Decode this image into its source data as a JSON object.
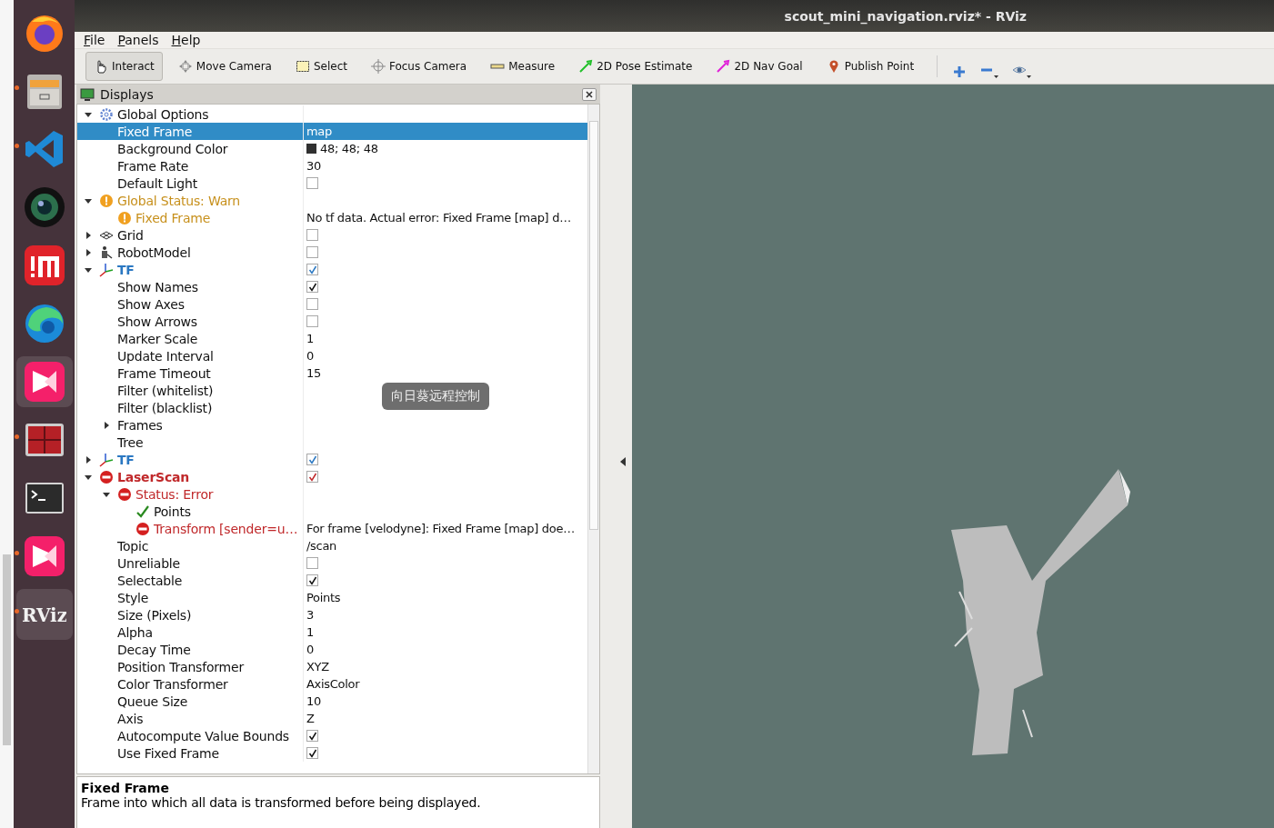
{
  "dock": [
    {
      "kind": "firefox",
      "running": false,
      "highlighted": false
    },
    {
      "kind": "files",
      "running": true,
      "highlighted": false
    },
    {
      "kind": "vscode",
      "running": true,
      "highlighted": false
    },
    {
      "kind": "camera",
      "running": false,
      "highlighted": false
    },
    {
      "kind": "im",
      "running": false,
      "highlighted": false
    },
    {
      "kind": "edge",
      "running": false,
      "highlighted": false
    },
    {
      "kind": "remote",
      "running": false,
      "highlighted": true
    },
    {
      "kind": "monitor",
      "running": true,
      "highlighted": false
    },
    {
      "kind": "terminal",
      "running": false,
      "highlighted": false
    },
    {
      "kind": "remote",
      "running": true,
      "highlighted": false
    },
    {
      "kind": "rviz",
      "running": true,
      "highlighted": true,
      "logo_text": "RViz"
    }
  ],
  "window": {
    "title": "scout_mini_navigation.rviz* - RViz"
  },
  "menu": [
    {
      "label": "File"
    },
    {
      "label": "Panels"
    },
    {
      "label": "Help"
    }
  ],
  "tools": [
    {
      "label": "Interact",
      "kind": "hand",
      "selected": true
    },
    {
      "label": "Move Camera",
      "kind": "move",
      "selected": false
    },
    {
      "label": "Select",
      "kind": "select",
      "selected": false
    },
    {
      "label": "Focus Camera",
      "kind": "focus",
      "selected": false
    },
    {
      "label": "Measure",
      "kind": "ruler",
      "selected": false
    },
    {
      "label": "2D Pose Estimate",
      "kind": "pose",
      "selected": false
    },
    {
      "label": "2D Nav Goal",
      "kind": "goal",
      "selected": false
    },
    {
      "label": "Publish Point",
      "kind": "pin",
      "selected": false
    }
  ],
  "tool_actions": [
    {
      "kind": "plus"
    },
    {
      "kind": "minus"
    },
    {
      "kind": "eye"
    }
  ],
  "displays": {
    "title": "Displays",
    "tree": [
      {
        "label": "Global Options",
        "kind": "gear",
        "expanded": true,
        "children": [
          {
            "label": "Fixed Frame",
            "value": "map",
            "selected": true
          },
          {
            "label": "Background Color",
            "value": "48; 48; 48",
            "color": "#303030",
            "selected": false
          },
          {
            "label": "Frame Rate",
            "value": "30",
            "selected": false
          },
          {
            "label": "Default Light",
            "checked": false,
            "selected": false
          }
        ]
      },
      {
        "label": "Global Status: Warn",
        "kind": "warn",
        "expanded": true,
        "children": [
          {
            "label": "Fixed Frame",
            "kind": "warn",
            "value": "No tf data.  Actual error: Fixed Frame [map] d…",
            "selected": false
          }
        ]
      },
      {
        "label": "Grid",
        "kind": "grid",
        "expanded": false,
        "checked": false
      },
      {
        "label": "RobotModel",
        "kind": "robot",
        "expanded": false,
        "checked": false
      },
      {
        "label": "TF",
        "kind": "axes",
        "bold": true,
        "expanded": true,
        "checked": true,
        "children": [
          {
            "label": "Show Names",
            "checked": true,
            "selected": false
          },
          {
            "label": "Show Axes",
            "checked": false,
            "selected": false
          },
          {
            "label": "Show Arrows",
            "checked": false,
            "selected": false
          },
          {
            "label": "Marker Scale",
            "value": "1",
            "selected": false
          },
          {
            "label": "Update Interval",
            "value": "0",
            "selected": false
          },
          {
            "label": "Frame Timeout",
            "value": "15",
            "selected": false
          },
          {
            "label": "Filter (whitelist)",
            "selected": false
          },
          {
            "label": "Filter (blacklist)",
            "selected": false
          },
          {
            "label": "Frames",
            "expanded": false,
            "selected": false
          },
          {
            "label": "Tree",
            "selected": false
          }
        ]
      },
      {
        "label": "TF",
        "kind": "axes",
        "bold": true,
        "expanded": false,
        "checked": true
      },
      {
        "label": "LaserScan",
        "kind": "error",
        "bold": true,
        "expanded": true,
        "checked": true,
        "children": [
          {
            "label": "Status: Error",
            "kind": "error",
            "expanded": true,
            "selected": false,
            "children": [
              {
                "label": "Points",
                "kind": "check",
                "selected": false
              },
              {
                "label": "Transform [sender=u…",
                "kind": "error",
                "value": "For frame [velodyne]: Fixed Frame [map] doe…",
                "selected": false
              }
            ]
          },
          {
            "label": "Topic",
            "value": "/scan",
            "selected": false
          },
          {
            "label": "Unreliable",
            "checked": false,
            "selected": false
          },
          {
            "label": "Selectable",
            "checked": true,
            "selected": false
          },
          {
            "label": "Style",
            "value": "Points",
            "selected": false
          },
          {
            "label": "Size (Pixels)",
            "value": "3",
            "selected": false
          },
          {
            "label": "Alpha",
            "value": "1",
            "selected": false
          },
          {
            "label": "Decay Time",
            "value": "0",
            "selected": false
          },
          {
            "label": "Position Transformer",
            "value": "XYZ",
            "selected": false
          },
          {
            "label": "Color Transformer",
            "value": "AxisColor",
            "selected": false
          },
          {
            "label": "Queue Size",
            "value": "10",
            "selected": false
          },
          {
            "label": "Axis",
            "value": "Z",
            "selected": false
          },
          {
            "label": "Autocompute Value Bounds",
            "checked": true,
            "selected": false
          },
          {
            "label": "Use Fixed Frame",
            "checked": true,
            "selected": false
          }
        ]
      }
    ],
    "description": {
      "title": "Fixed Frame",
      "text": "Frame into which all data is transformed before being displayed."
    }
  },
  "tooltip": {
    "text": "向日葵远程控制"
  }
}
